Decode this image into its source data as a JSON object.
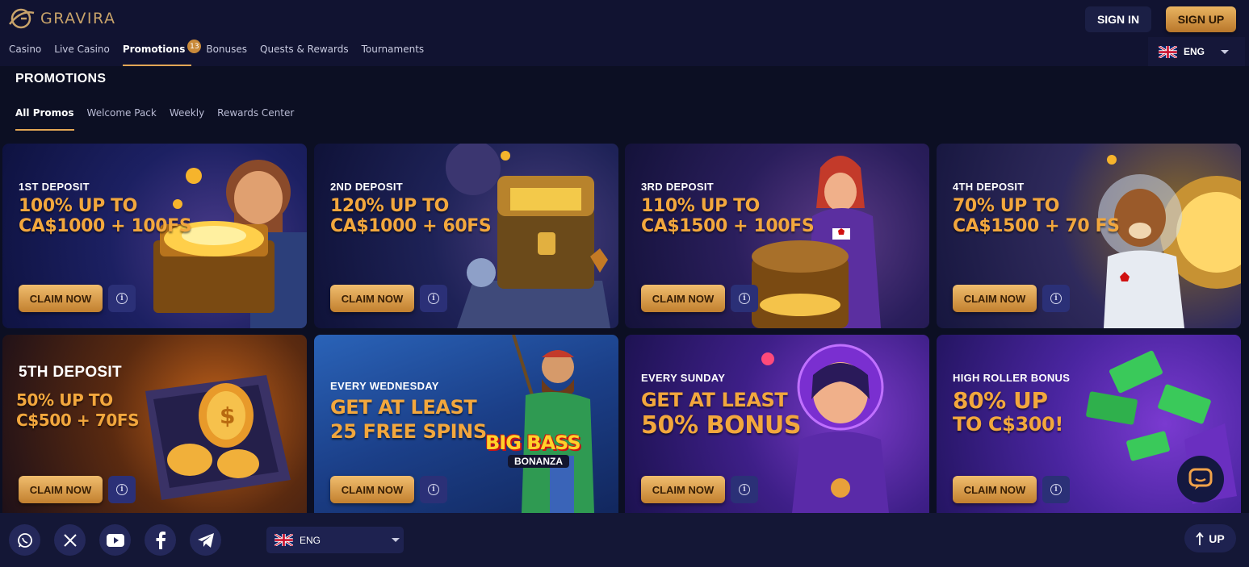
{
  "brand": {
    "name": "GRAVIRA"
  },
  "header": {
    "nav": [
      {
        "label": "Casino"
      },
      {
        "label": "Live Casino"
      },
      {
        "label": "Promotions",
        "badge": "13"
      },
      {
        "label": "Bonuses"
      },
      {
        "label": "Quests & Rewards"
      },
      {
        "label": "Tournaments"
      }
    ],
    "sign_in": "SIGN IN",
    "sign_up": "SIGN UP",
    "language": "ENG"
  },
  "page": {
    "title": "PROMOTIONS",
    "tabs": [
      {
        "label": "All Promos"
      },
      {
        "label": "Welcome Pack"
      },
      {
        "label": "Weekly"
      },
      {
        "label": "Rewards Center"
      }
    ]
  },
  "promos": [
    {
      "label": "1ST DEPOSIT",
      "line1": "100% UP TO",
      "line2": "CA$1000 + 100FS",
      "cta": "CLAIM NOW"
    },
    {
      "label": "2ND DEPOSIT",
      "line1": "120% UP TO",
      "line2": "CA$1000 + 60FS",
      "cta": "CLAIM NOW"
    },
    {
      "label": "3RD DEPOSIT",
      "line1": "110% UP TO",
      "line2": "CA$1500 + 100FS",
      "cta": "CLAIM NOW"
    },
    {
      "label": "4TH DEPOSIT",
      "line1": "70% UP TO",
      "line2": "CA$1500 + 70 FS",
      "cta": "CLAIM NOW"
    },
    {
      "label": "5TH DEPOSIT",
      "line1": "50% UP TO",
      "line2": "C$500 + 70FS",
      "cta": "CLAIM NOW"
    },
    {
      "label": "EVERY WEDNESDAY",
      "line1": "GET AT LEAST",
      "line2": "25 FREE SPINS",
      "cta": "CLAIM NOW",
      "art_text": [
        "BIG BASS",
        "BONANZA"
      ]
    },
    {
      "label": "EVERY SUNDAY",
      "line1": "GET AT LEAST",
      "line2": "50% BONUS",
      "cta": "CLAIM NOW"
    },
    {
      "label": "HIGH ROLLER BONUS",
      "line1": "80% UP",
      "line2": "TO C$300!",
      "cta": "CLAIM NOW"
    }
  ],
  "footer": {
    "socials": [
      "whatsapp-icon",
      "x-icon",
      "youtube-icon",
      "facebook-icon",
      "telegram-icon"
    ],
    "language": "ENG",
    "up_label": "UP"
  },
  "colors": {
    "background": "#0c0f23",
    "header": "#111331",
    "accent_gold": "#e2a655",
    "offer_text": "#f2a73d",
    "info_button": "#2b3077"
  }
}
